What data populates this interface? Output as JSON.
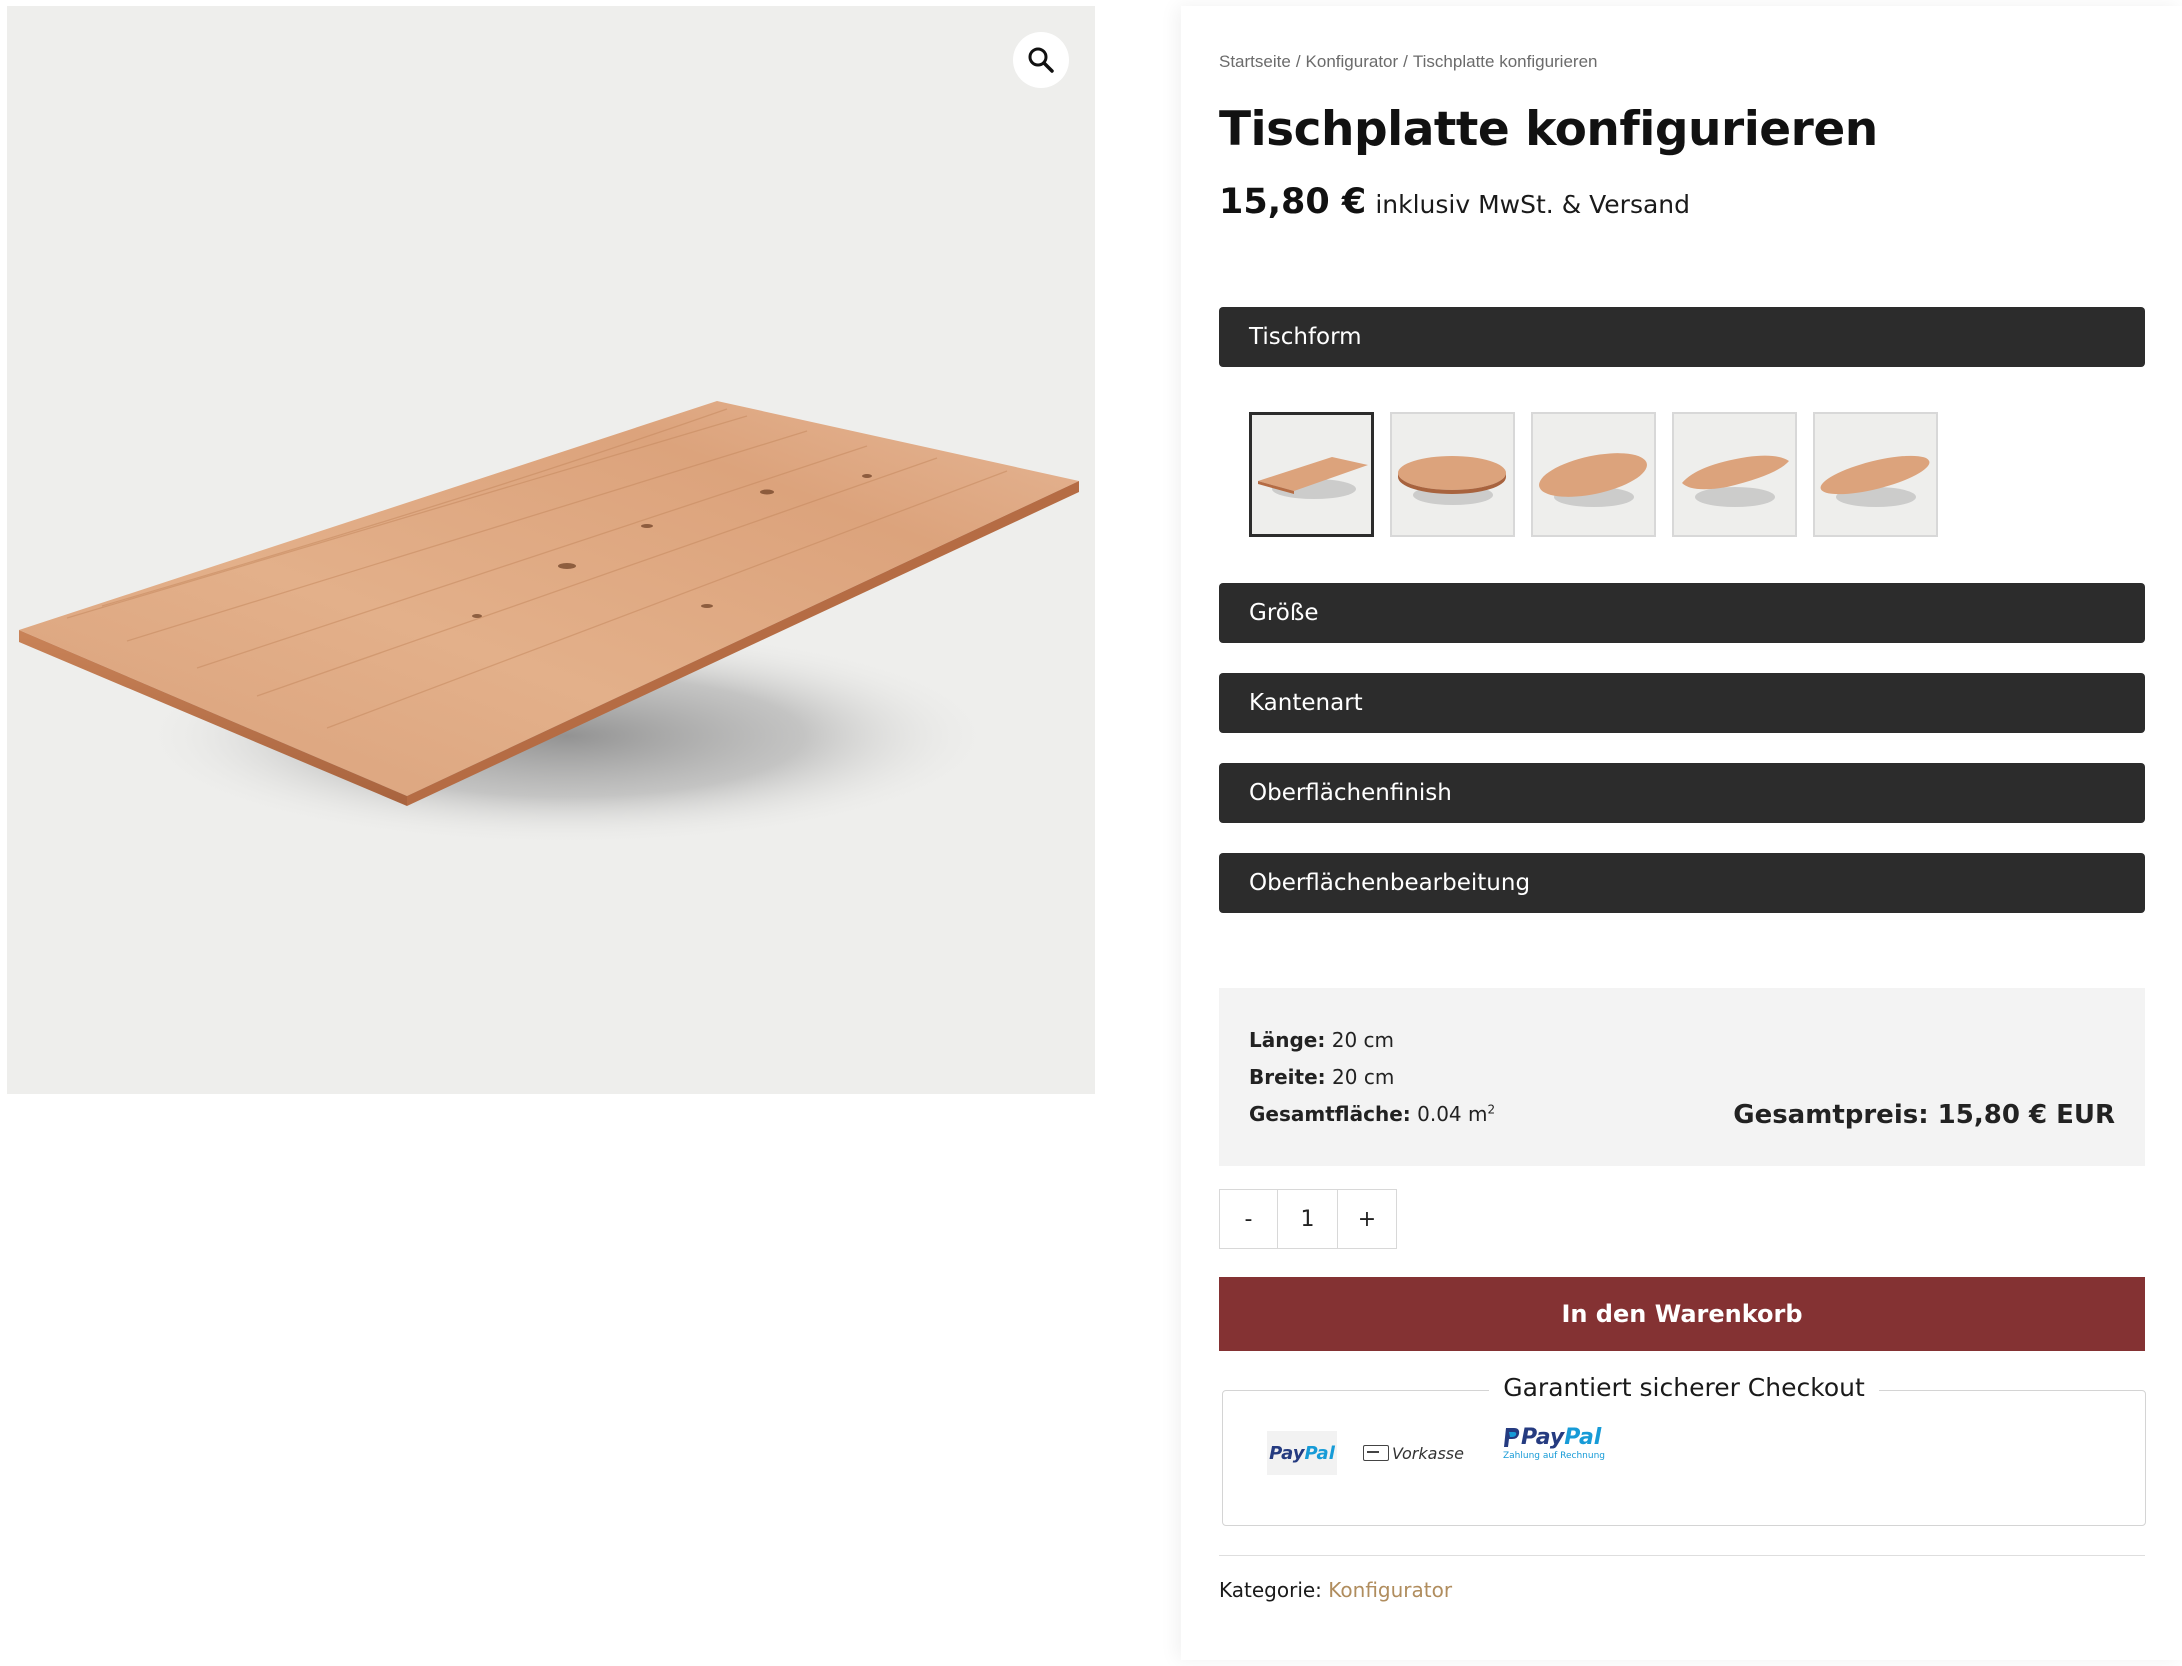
{
  "breadcrumb": {
    "items": [
      "Startseite",
      "Konfigurator",
      "Tischplatte konfigurieren"
    ],
    "separator": "/"
  },
  "product": {
    "title": "Tischplatte konfigurieren",
    "price": "15,80 €",
    "price_note": "inklusiv MwSt. & Versand"
  },
  "accordion": {
    "tischform": "Tischform",
    "groesse": "Größe",
    "kantenart": "Kantenart",
    "oberflaechenfinish": "Oberflächenfinish",
    "oberflaechenbearbeitung": "Oberflächenbearbeitung"
  },
  "shape_options": [
    {
      "name": "rechteck",
      "selected": true
    },
    {
      "name": "rund",
      "selected": false
    },
    {
      "name": "oval",
      "selected": false
    },
    {
      "name": "bootsform",
      "selected": false
    },
    {
      "name": "elliptisch",
      "selected": false
    }
  ],
  "summary": {
    "laenge_label": "Länge:",
    "laenge_value": "20 cm",
    "breite_label": "Breite:",
    "breite_value": "20 cm",
    "flaeche_label": "Gesamtfläche:",
    "flaeche_value": "0.04 m",
    "flaeche_exp": "2",
    "total_label": "Gesamtpreis:",
    "total_value": "15,80 € EUR"
  },
  "quantity": {
    "minus": "-",
    "value": "1",
    "plus": "+"
  },
  "cart_button": "In den Warenkorb",
  "checkout": {
    "title": "Garantiert sicherer Checkout",
    "paypal_a": "Pay",
    "paypal_b": "Pal",
    "vorkasse": "Vorkasse",
    "rechnung_sub": "Zahlung auf Rechnung"
  },
  "category": {
    "label": "Kategorie:",
    "link": "Konfigurator"
  },
  "colors": {
    "accordion_bg": "#2c2c2c",
    "cart_button_bg": "#843233",
    "image_bg": "#eeeeec",
    "category_link": "#b08d5e"
  },
  "icons": {
    "zoom": "magnifier-icon"
  }
}
